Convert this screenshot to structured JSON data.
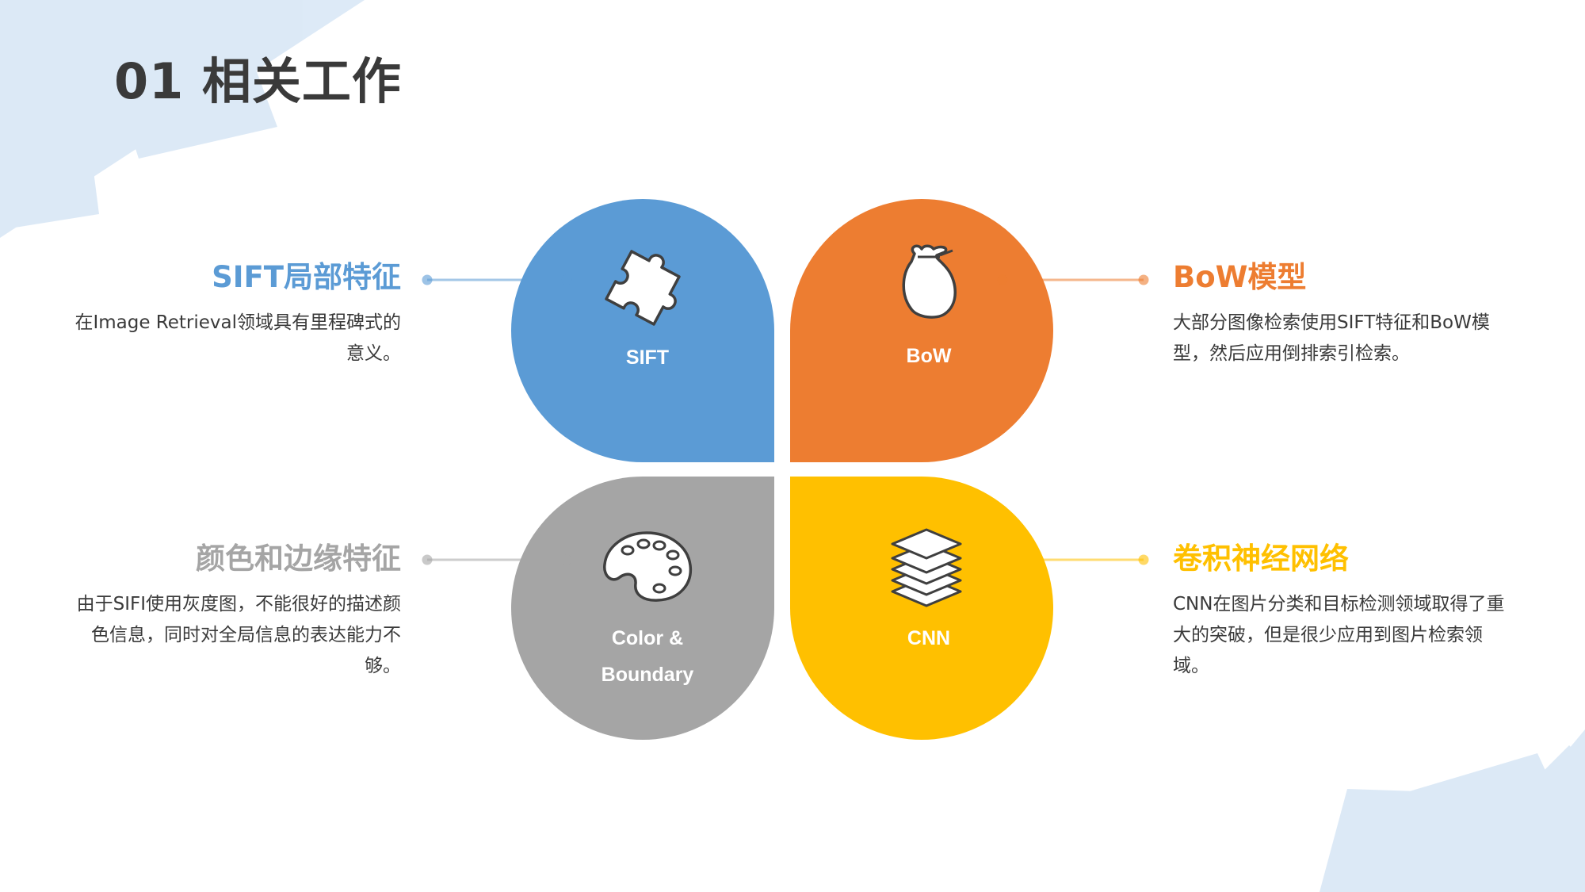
{
  "header": {
    "title": "01 相关工作"
  },
  "colors": {
    "blue": "#5B9BD5",
    "orange": "#ED7D31",
    "gray": "#A5A5A5",
    "yellow": "#FFC000",
    "title": "#3A3A3A",
    "text": "#3A3A3A"
  },
  "petals": [
    {
      "id": "sift",
      "label": "SIFT",
      "icon": "puzzle-icon",
      "color": "#5B9BD5"
    },
    {
      "id": "bow",
      "label": "BoW",
      "icon": "money-bag-icon",
      "color": "#ED7D31"
    },
    {
      "id": "color",
      "label_line1": "Color &",
      "label_line2": "Boundary",
      "icon": "palette-icon",
      "color": "#A5A5A5"
    },
    {
      "id": "cnn",
      "label": "CNN",
      "icon": "layers-icon",
      "color": "#FFC000"
    }
  ],
  "topics": {
    "sift": {
      "title": "SIFT局部特征",
      "desc": "在Image Retrieval领域具有里程碑式的意义。"
    },
    "bow": {
      "title": "BoW模型",
      "desc": "大部分图像检索使用SIFT特征和BoW模型，然后应用倒排索引检索。"
    },
    "color": {
      "title": "颜色和边缘特征",
      "desc": "由于SIFI使用灰度图，不能很好的描述颜色信息，同时对全局信息的表达能力不够。"
    },
    "cnn": {
      "title": "卷积神经网络",
      "desc": "CNN在图片分类和目标检测领域取得了重大的突破，但是很少应用到图片检索领域。"
    }
  }
}
